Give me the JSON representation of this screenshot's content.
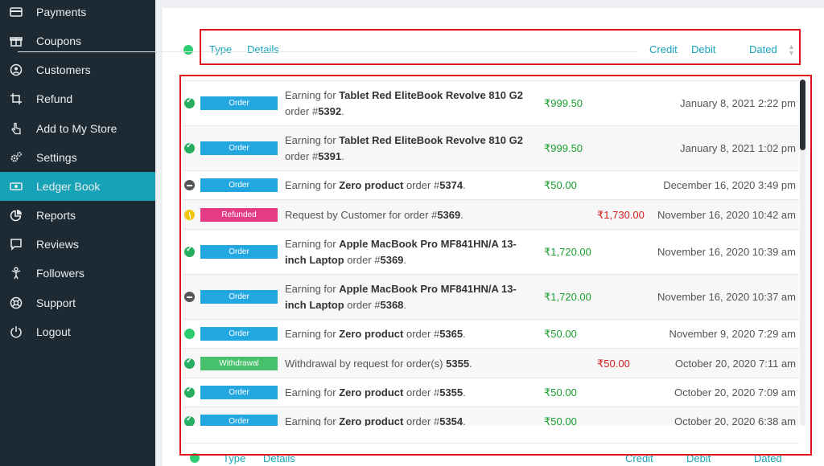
{
  "sidebar": {
    "items": [
      {
        "label": "Payments",
        "icon": "credit-card-icon"
      },
      {
        "label": "Coupons",
        "icon": "gift-icon"
      },
      {
        "label": "Customers",
        "icon": "user-circle-icon"
      },
      {
        "label": "Refund",
        "icon": "crop-icon"
      },
      {
        "label": "Add to My Store",
        "icon": "hand-pointer-icon"
      },
      {
        "label": "Settings",
        "icon": "cogs-icon"
      },
      {
        "label": "Ledger Book",
        "icon": "money-bill-icon"
      },
      {
        "label": "Reports",
        "icon": "pie-chart-icon"
      },
      {
        "label": "Reviews",
        "icon": "comment-icon"
      },
      {
        "label": "Followers",
        "icon": "child-icon"
      },
      {
        "label": "Support",
        "icon": "life-ring-icon"
      },
      {
        "label": "Logout",
        "icon": "power-icon"
      }
    ],
    "active": "Ledger Book"
  },
  "table": {
    "header": {
      "type": "Type",
      "details": "Details",
      "credit": "Credit",
      "debit": "Debit",
      "dated": "Dated"
    },
    "footer": {
      "type": "Type",
      "details": "Details",
      "credit": "Credit",
      "debit": "Debit",
      "dated": "Dated"
    },
    "rows": [
      {
        "status": "ok",
        "type": "Order",
        "pre": "Earning for ",
        "bold": "Tablet Red EliteBook Revolve 810 G2",
        "mid": " order #",
        "num": "5392",
        "post": ".",
        "credit": "₹999.50",
        "debit": "",
        "dated": "January 8, 2021 2:22 pm"
      },
      {
        "status": "ok",
        "type": "Order",
        "pre": "Earning for ",
        "bold": "Tablet Red EliteBook Revolve 810 G2",
        "mid": " order #",
        "num": "5391",
        "post": ".",
        "credit": "₹999.50",
        "debit": "",
        "dated": "January 8, 2021 1:02 pm"
      },
      {
        "status": "minus",
        "type": "Order",
        "pre": "Earning for ",
        "bold": "Zero product",
        "mid": " order #",
        "num": "5374",
        "post": ".",
        "credit": "₹50.00",
        "debit": "",
        "dated": "December 16, 2020 3:49 pm"
      },
      {
        "status": "pending",
        "type": "Refunded",
        "pre": "Request by Customer for order #",
        "bold": "",
        "mid": "",
        "num": "5369",
        "post": ".",
        "credit": "",
        "debit": "₹1,730.00",
        "dated": "November 16, 2020 10:42 am"
      },
      {
        "status": "ok",
        "type": "Order",
        "pre": "Earning for ",
        "bold": "Apple MacBook Pro MF841HN/A 13-inch Laptop",
        "mid": " order #",
        "num": "5369",
        "post": ".",
        "credit": "₹1,720.00",
        "debit": "",
        "dated": "November 16, 2020 10:39 am"
      },
      {
        "status": "minus",
        "type": "Order",
        "pre": "Earning for ",
        "bold": "Apple MacBook Pro MF841HN/A 13-inch Laptop",
        "mid": " order #",
        "num": "5368",
        "post": ".",
        "credit": "₹1,720.00",
        "debit": "",
        "dated": "November 16, 2020 10:37 am"
      },
      {
        "status": "dots",
        "type": "Order",
        "pre": "Earning for ",
        "bold": "Zero product",
        "mid": " order #",
        "num": "5365",
        "post": ".",
        "credit": "₹50.00",
        "debit": "",
        "dated": "November 9, 2020 7:29 am"
      },
      {
        "status": "ok",
        "type": "Withdrawal",
        "pre": "Withdrawal by request for order(s) ",
        "bold": "",
        "mid": "",
        "num": "5355",
        "post": ".",
        "credit": "",
        "debit": "₹50.00",
        "dated": "October 20, 2020 7:11 am"
      },
      {
        "status": "ok",
        "type": "Order",
        "pre": "Earning for ",
        "bold": "Zero product",
        "mid": " order #",
        "num": "5355",
        "post": ".",
        "credit": "₹50.00",
        "debit": "",
        "dated": "October 20, 2020 7:09 am"
      },
      {
        "status": "ok",
        "type": "Order",
        "pre": "Earning for ",
        "bold": "Zero product",
        "mid": " order #",
        "num": "5354",
        "post": ".",
        "credit": "₹50.00",
        "debit": "",
        "dated": "October 20, 2020 6:38 am"
      }
    ]
  },
  "colors": {
    "sidebar_bg": "#1e2a33",
    "active": "#17a2b8",
    "highlight_box": "#e0141e",
    "credit": "#1a9e2f",
    "debit": "#d01f1f"
  }
}
